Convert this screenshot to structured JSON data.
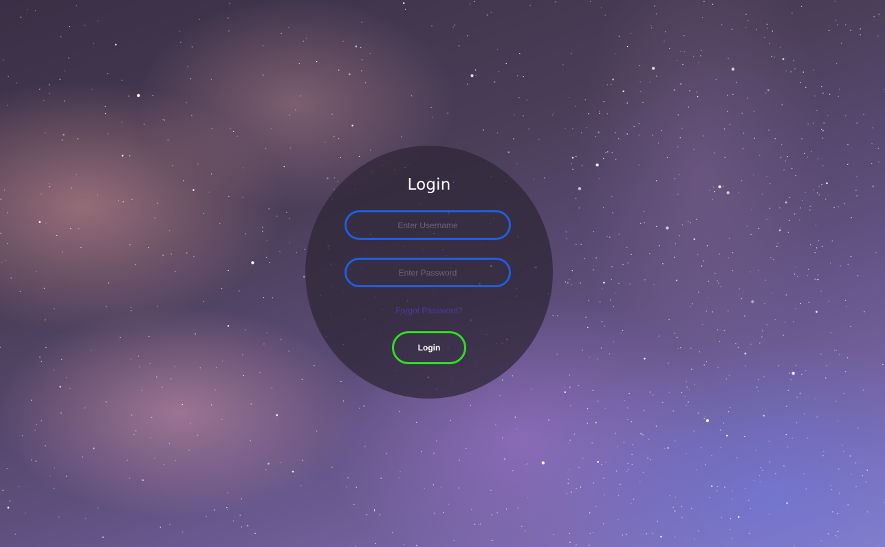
{
  "background": {
    "description_colors": [
      "#3a2f45",
      "#5e4e7c",
      "#8a80c8",
      "#d69696"
    ]
  },
  "login": {
    "title": "Login",
    "username": {
      "placeholder": "Enter Username",
      "value": ""
    },
    "password": {
      "placeholder": "Enter Password",
      "value": ""
    },
    "forgot_label": "Forgot Password?",
    "button_label": "Login"
  },
  "colors": {
    "input_border": "#1d5fe0",
    "button_border": "#2ee021",
    "link": "#4e3aa0",
    "panel": "#2d2634"
  }
}
